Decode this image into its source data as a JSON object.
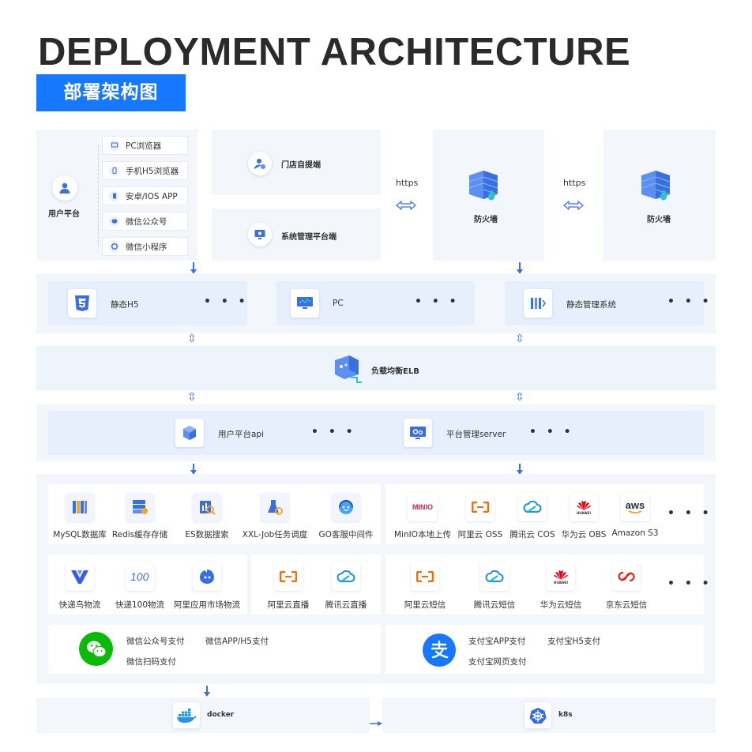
{
  "header": {
    "title_en": "DEPLOYMENT ARCHITECTURE",
    "title_cn": "部署架构图"
  },
  "clients": {
    "user_platform": "用户平台",
    "items": [
      "PC浏览器",
      "手机H5浏览器",
      "安卓/IOS APP",
      "微信公众号",
      "微信小程序"
    ],
    "store_client": "门店自提端",
    "admin_client": "系统管理平台端"
  },
  "network": {
    "https_1": "https",
    "https_2": "https",
    "firewall_1": "防火墙",
    "firewall_2": "防火墙"
  },
  "frontend": {
    "h5": "静态H5",
    "pc": "PC",
    "admin": "静态管理系统",
    "more": "• • •"
  },
  "elb": {
    "label": "负载均衡ELB"
  },
  "api": {
    "user_api": "用户平台api",
    "admin_server": "平台管理server",
    "more": "• • •"
  },
  "middleware": [
    "MySQL数据库",
    "Redis缓存存储",
    "ES数据搜索",
    "XXL-Job任务调度",
    "GO客服中间件"
  ],
  "storage": {
    "items": [
      "MinIO本地上传",
      "阿里云 OSS",
      "腾讯云 COS",
      "华为云 OBS",
      "Amazon S3"
    ],
    "more": "• • •",
    "minio_logo": "MINIO",
    "aws_logo": "aws",
    "huawei_logo": "HUAWEI"
  },
  "logistics": [
    "快递鸟物流",
    "快递100物流",
    "阿里应用市场物流"
  ],
  "live": [
    "阿里云直播",
    "腾讯云直播"
  ],
  "sms": {
    "items": [
      "阿里云短信",
      "腾讯云短信",
      "华为云短信",
      "京东云短信"
    ],
    "more": "• • •"
  },
  "wechat_pay": {
    "items": [
      "微信公众号支付",
      "微信APP/H5支付",
      "微信扫码支付"
    ]
  },
  "alipay": {
    "items": [
      "支付宝APP支付",
      "支付宝H5支付",
      "支付宝网页支付"
    ]
  },
  "deploy": {
    "docker": "docker",
    "k8s": "k8s"
  },
  "colors": {
    "accent": "#1677ff",
    "arrow": "#3a6fe0",
    "panel": "#f3f7fc",
    "cell": "#e6effb",
    "alibaba": "#ff6a00",
    "huawei": "#e60012",
    "wechat": "#09bb07",
    "alipay": "#1677ff"
  }
}
